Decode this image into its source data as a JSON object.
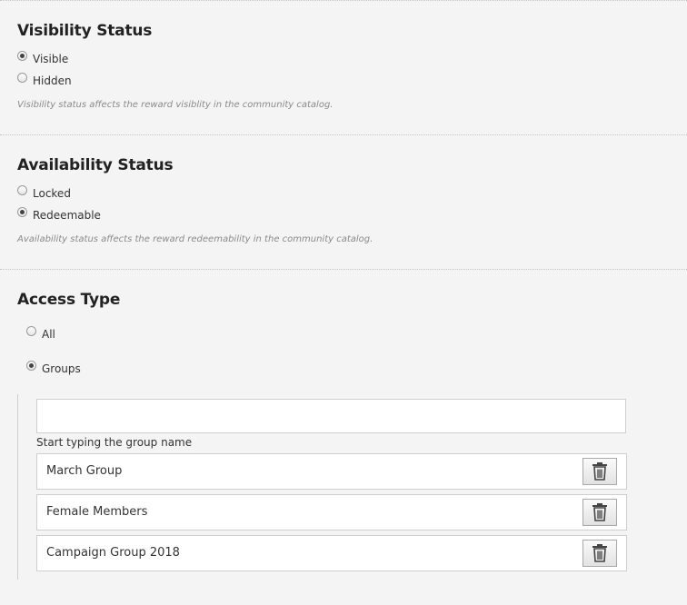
{
  "visibility": {
    "title": "Visibility Status",
    "options": [
      {
        "label": "Visible",
        "checked": true
      },
      {
        "label": "Hidden",
        "checked": false
      }
    ],
    "help": "Visibility status affects the reward visiblity in the community catalog."
  },
  "availability": {
    "title": "Availability Status",
    "options": [
      {
        "label": "Locked",
        "checked": false
      },
      {
        "label": "Redeemable",
        "checked": true
      }
    ],
    "help": "Availability status affects the reward redeemability in the community catalog."
  },
  "access": {
    "title": "Access Type",
    "options": [
      {
        "label": "All",
        "checked": false
      },
      {
        "label": "Groups",
        "checked": true
      }
    ],
    "group_input": {
      "value": "",
      "caption": "Start typing the group name"
    },
    "groups": [
      {
        "name": "March Group",
        "delete_icon": "trash-icon"
      },
      {
        "name": "Female Members",
        "delete_icon": "trash-icon"
      },
      {
        "name": "Campaign Group 2018",
        "delete_icon": "trash-icon"
      }
    ]
  }
}
